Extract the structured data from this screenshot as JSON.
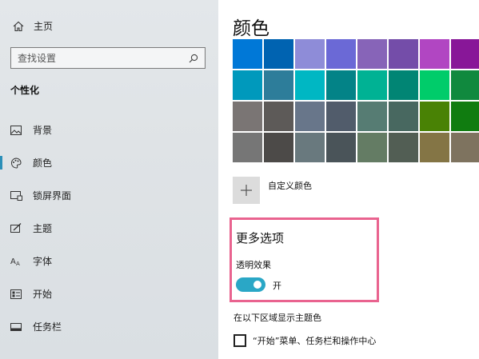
{
  "sidebar": {
    "home_label": "主页",
    "search_placeholder": "查找设置",
    "section_title": "个性化",
    "items": [
      {
        "label": "背景",
        "icon": "image-icon"
      },
      {
        "label": "颜色",
        "icon": "palette-icon",
        "active": true
      },
      {
        "label": "锁屏界面",
        "icon": "lock-screen-icon"
      },
      {
        "label": "主题",
        "icon": "theme-brush-icon"
      },
      {
        "label": "字体",
        "icon": "font-icon"
      },
      {
        "label": "开始",
        "icon": "start-icon"
      },
      {
        "label": "任务栏",
        "icon": "taskbar-icon"
      }
    ]
  },
  "main": {
    "title": "颜色",
    "swatches": [
      "#0078d7",
      "#0063b1",
      "#8e8cd8",
      "#6b69d6",
      "#8764b8",
      "#744da9",
      "#b146c2",
      "#881798",
      "#0099bc",
      "#2d7d9a",
      "#00b7c3",
      "#038387",
      "#00b294",
      "#018574",
      "#00cc6a",
      "#10893e",
      "#7a7574",
      "#5d5a58",
      "#68768a",
      "#515c6b",
      "#567c73",
      "#486860",
      "#498205",
      "#107c10",
      "#767676",
      "#4c4a48",
      "#69797e",
      "#4a5459",
      "#647c64",
      "#525e54",
      "#847545",
      "#7e735f"
    ],
    "custom_color_label": "自定义颜色",
    "more_options": {
      "title": "更多选项",
      "transparency_label": "透明效果",
      "toggle_state": "开",
      "toggle_on": true,
      "accent_color": "#2aa7c6"
    },
    "show_accent_label": "在以下区域显示主题色",
    "checkbox_label": "“开始”菜单、任务栏和操作中心",
    "checkbox_checked": false
  }
}
